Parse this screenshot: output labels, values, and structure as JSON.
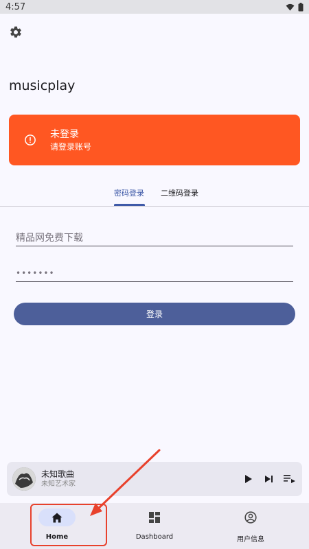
{
  "status_bar": {
    "time": "4:57"
  },
  "app": {
    "title": "musicplay"
  },
  "alert": {
    "title": "未登录",
    "subtitle": "请登录账号",
    "color": "#ff5722"
  },
  "tabs": [
    {
      "label": "密码登录",
      "selected": true
    },
    {
      "label": "二维码登录",
      "selected": false
    }
  ],
  "form": {
    "username_placeholder": "精品网免费下载",
    "password_value": "•••••••",
    "login_label": "登录"
  },
  "player": {
    "song_title": "未知歌曲",
    "artist": "未知艺术家"
  },
  "nav": [
    {
      "label": "Home",
      "icon": "home-icon",
      "selected": true
    },
    {
      "label": "Dashboard",
      "icon": "dashboard-icon",
      "selected": false
    },
    {
      "label": "用户信息",
      "icon": "account-circle-icon",
      "selected": false
    }
  ],
  "colors": {
    "accent": "#3f5aa8",
    "button": "#4d5f9a",
    "annotation": "#e8412c"
  }
}
